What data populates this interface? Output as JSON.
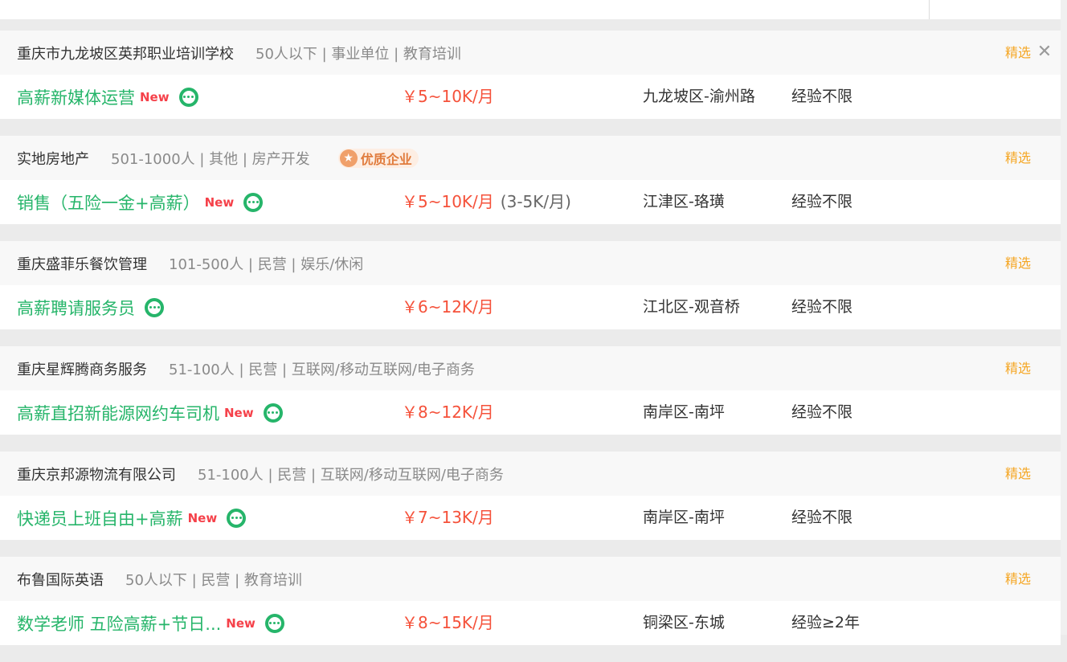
{
  "featured_label": "精选",
  "jobs": [
    {
      "company": "重庆市九龙坡区英邦职业培训学校",
      "info": "50人以下 | 事业单位 | 教育培训",
      "badge": "",
      "title": "高薪新媒体运营",
      "new_label": "New",
      "salary": "￥5~10K/月",
      "salary_extra": "",
      "location": "九龙坡区-渝州路",
      "experience": "经验不限"
    },
    {
      "company": "实地房地产",
      "info": "501-1000人 | 其他 | 房产开发",
      "badge": "优质企业",
      "title": "销售（五险一金+高薪）",
      "new_label": "New",
      "salary": "￥5~10K/月",
      "salary_extra": "(3-5K/月)",
      "location": "江津区-珞璜",
      "experience": "经验不限"
    },
    {
      "company": "重庆盛菲乐餐饮管理",
      "info": "101-500人 | 民营 | 娱乐/休闲",
      "badge": "",
      "title": "高薪聘请服务员",
      "new_label": "",
      "salary": "￥6~12K/月",
      "salary_extra": "",
      "location": "江北区-观音桥",
      "experience": "经验不限"
    },
    {
      "company": "重庆星辉腾商务服务",
      "info": "51-100人 | 民营 | 互联网/移动互联网/电子商务",
      "badge": "",
      "title": "高薪直招新能源网约车司机",
      "new_label": "New",
      "salary": "￥8~12K/月",
      "salary_extra": "",
      "location": "南岸区-南坪",
      "experience": "经验不限"
    },
    {
      "company": "重庆京邦源物流有限公司",
      "info": "51-100人 | 民营 | 互联网/移动互联网/电子商务",
      "badge": "",
      "title": "快递员上班自由+高薪",
      "new_label": "New",
      "salary": "￥7~13K/月",
      "salary_extra": "",
      "location": "南岸区-南坪",
      "experience": "经验不限"
    },
    {
      "company": "布鲁国际英语",
      "info": "50人以下 | 民营 | 教育培训",
      "badge": "",
      "title": "数学老师 五险高薪+节日...",
      "new_label": "New",
      "salary": "￥8~15K/月",
      "salary_extra": "",
      "location": "铜梁区-东城",
      "experience": "经验≥2年"
    }
  ]
}
